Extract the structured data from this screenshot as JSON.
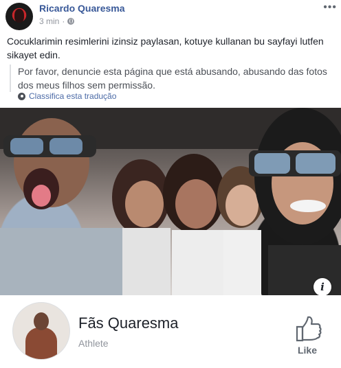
{
  "post": {
    "author": "Ricardo Quaresma",
    "time": "3 min",
    "more_icon": "more-icon",
    "text": "Cocuklarimin resimlerini izinsiz paylasan, kotuye kullanan bu sayfayi lutfen sikayet edin.",
    "translation": "Por favor, denuncie esta página que está abusando, abusando das fotos dos meus filhos sem permissão.",
    "translate_link": "Classifica esta tradução"
  },
  "photo": {
    "info_icon_label": "i"
  },
  "page_card": {
    "name": "Fãs Quaresma",
    "category": "Athlete",
    "like_label": "Like"
  },
  "colors": {
    "link": "#385898",
    "secondary": "#90949c",
    "text": "#1d2129"
  }
}
